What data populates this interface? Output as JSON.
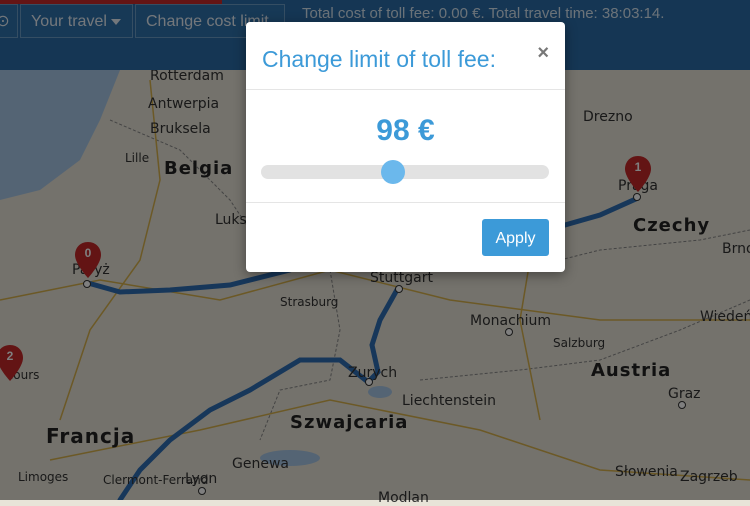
{
  "toolbar": {
    "travel_label": "Your travel",
    "change_cost_label": "Change cost limit",
    "summary": "Total cost of toll fee: 0.00 €. Total travel time: 38:03:14."
  },
  "modal": {
    "title": "Change limit of toll fee:",
    "close": "×",
    "value": "98 €",
    "slider_fraction": 0.46,
    "apply_label": "Apply"
  },
  "map": {
    "countries": [
      "Belgia",
      "Francja",
      "Czechy",
      "Austria",
      "Szwajcaria",
      "Słowenia"
    ],
    "cities": [
      "Rotterdam",
      "Antwerpia",
      "Bruksela",
      "Lille",
      "Luks",
      "Paryż",
      "Strasburg",
      "Stuttgart",
      "Monachium",
      "Salzburg",
      "Zurych",
      "Liechtenstein",
      "Genewa",
      "Lyon",
      "Limoges",
      "Clermont-Ferrand",
      "Graz",
      "Zagrzeb",
      "Wiedeń",
      "Brno",
      "Praga",
      "Drezno",
      "Modlan",
      "Tours"
    ],
    "markers": [
      "0",
      "1",
      "2"
    ]
  },
  "colors": {
    "accent": "#3c9ad8",
    "topbar": "#2a6ca8",
    "route": "#2f6eb5",
    "marker": "#c62828"
  }
}
